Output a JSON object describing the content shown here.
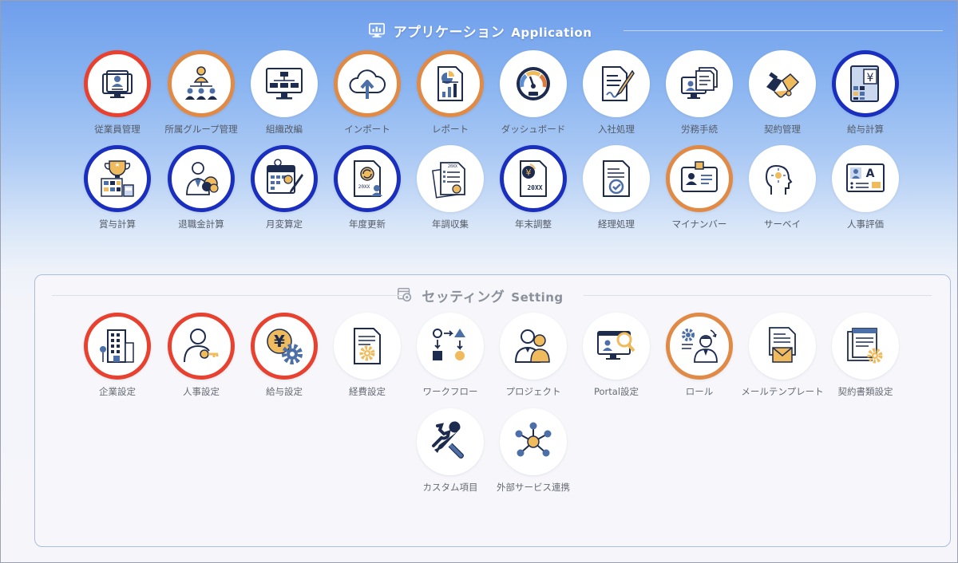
{
  "sections": {
    "application": {
      "title_ja": "アプリケーション",
      "title_en": "Application",
      "icon": "monitor-chart-icon"
    },
    "setting": {
      "title_ja": "セッティング",
      "title_en": "Setting",
      "icon": "gear-window-icon"
    }
  },
  "ring_colors": {
    "red": "#e8412f",
    "orange": "#e08a45",
    "blue": "#1b2fbf"
  },
  "application_items": [
    {
      "label": "従業員管理",
      "icon": "employee-id-icon",
      "ring": "red"
    },
    {
      "label": "所属グループ管理",
      "icon": "org-group-icon",
      "ring": "orange"
    },
    {
      "label": "組織改編",
      "icon": "org-chart-monitor-icon",
      "ring": "none"
    },
    {
      "label": "インポート",
      "icon": "cloud-upload-icon",
      "ring": "orange"
    },
    {
      "label": "レポート",
      "icon": "report-icon",
      "ring": "orange"
    },
    {
      "label": "ダッシュボード",
      "icon": "gauge-icon",
      "ring": "none"
    },
    {
      "label": "入社処理",
      "icon": "sign-document-icon",
      "ring": "none"
    },
    {
      "label": "労務手続",
      "icon": "labor-procedure-icon",
      "ring": "none"
    },
    {
      "label": "契約管理",
      "icon": "handshake-icon",
      "ring": "none"
    },
    {
      "label": "給与計算",
      "icon": "yen-calculator-icon",
      "ring": "blue"
    },
    {
      "label": "賞与計算",
      "icon": "trophy-calc-icon",
      "ring": "blue"
    },
    {
      "label": "退職金計算",
      "icon": "retirement-money-icon",
      "ring": "blue"
    },
    {
      "label": "月変算定",
      "icon": "calendar-edit-icon",
      "ring": "blue"
    },
    {
      "label": "年度更新",
      "icon": "annual-update-icon",
      "ring": "blue"
    },
    {
      "label": "年調収集",
      "icon": "tax-docs-icon",
      "ring": "none"
    },
    {
      "label": "年末調整",
      "icon": "year-end-adjust-icon",
      "ring": "blue",
      "doc_text": "20XX"
    },
    {
      "label": "経理処理",
      "icon": "accounting-check-icon",
      "ring": "none"
    },
    {
      "label": "マイナンバー",
      "icon": "id-card-icon",
      "ring": "orange"
    },
    {
      "label": "サーベイ",
      "icon": "survey-head-icon",
      "ring": "none"
    },
    {
      "label": "人事評価",
      "icon": "evaluation-board-icon",
      "ring": "none"
    }
  ],
  "setting_items": [
    {
      "label": "企業設定",
      "icon": "building-icon",
      "ring": "red"
    },
    {
      "label": "人事設定",
      "icon": "user-key-icon",
      "ring": "red"
    },
    {
      "label": "給与設定",
      "icon": "yen-gear-icon",
      "ring": "red"
    },
    {
      "label": "経費設定",
      "icon": "expense-doc-icon",
      "ring": "none"
    },
    {
      "label": "ワークフロー",
      "icon": "workflow-icon",
      "ring": "none"
    },
    {
      "label": "プロジェクト",
      "icon": "project-team-icon",
      "ring": "none"
    },
    {
      "label": "Portal設定",
      "icon": "portal-search-icon",
      "ring": "none"
    },
    {
      "label": "ロール",
      "icon": "role-icon",
      "ring": "orange"
    },
    {
      "label": "メールテンプレート",
      "icon": "mail-template-icon",
      "ring": "none"
    },
    {
      "label": "契約書類設定",
      "icon": "contract-docs-gear-icon",
      "ring": "none"
    },
    {
      "label": "カスタム項目",
      "icon": "wrench-screwdriver-icon",
      "ring": "none"
    },
    {
      "label": "外部サービス連携",
      "icon": "network-hub-icon",
      "ring": "none"
    }
  ]
}
